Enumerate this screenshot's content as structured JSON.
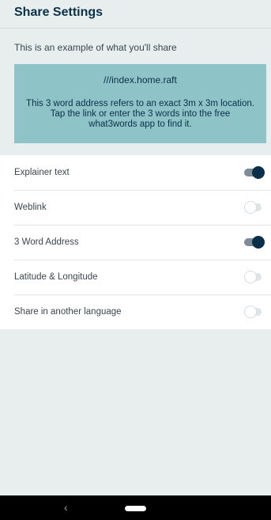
{
  "header": {
    "title": "Share Settings"
  },
  "intro": {
    "text": "This is an example of what you'll share"
  },
  "preview": {
    "address": "///index.home.raft",
    "description": "This 3 word address refers to an exact 3m x 3m location. Tap the link or enter the 3 words into the free what3words app to find it."
  },
  "settings": [
    {
      "label": "Explainer text",
      "enabled": true
    },
    {
      "label": "Weblink",
      "enabled": false
    },
    {
      "label": "3 Word Address",
      "enabled": true
    },
    {
      "label": "Latitude & Longitude",
      "enabled": false
    },
    {
      "label": "Share in another language",
      "enabled": false
    }
  ],
  "navbar": {
    "back_icon": "back-icon",
    "home_icon": "home-pill-icon"
  },
  "colors": {
    "brand_navy": "#0a3049",
    "preview_teal": "#8ec3c8",
    "background": "#e8edee"
  }
}
